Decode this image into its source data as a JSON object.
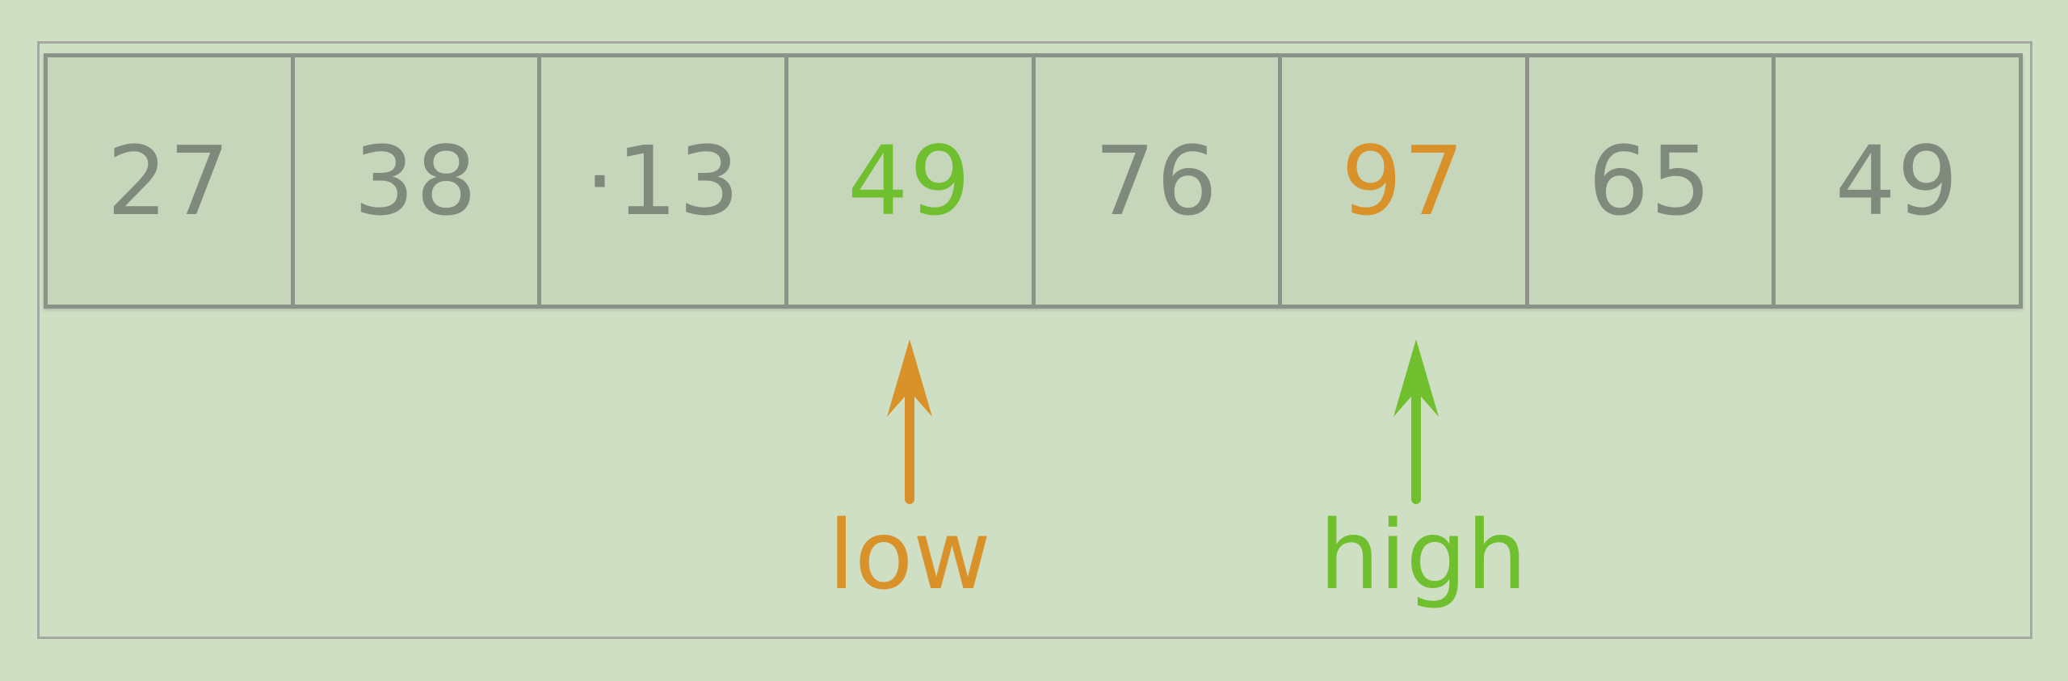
{
  "array": {
    "cells": [
      "27",
      "38",
      "·13",
      "49",
      "76",
      "97",
      "65",
      "49"
    ]
  },
  "pointers": {
    "low": {
      "label": "low",
      "color": "#d9922a"
    },
    "high": {
      "label": "high",
      "color": "#6fbf2f"
    }
  },
  "colors": {
    "background": "#cfdfc3",
    "cell_fill": "#c5d6bb",
    "cell_border": "#8b9288",
    "value_text": "#7f8a7c",
    "highlight_green": "#6fbf2f",
    "highlight_orange": "#d9922a"
  }
}
